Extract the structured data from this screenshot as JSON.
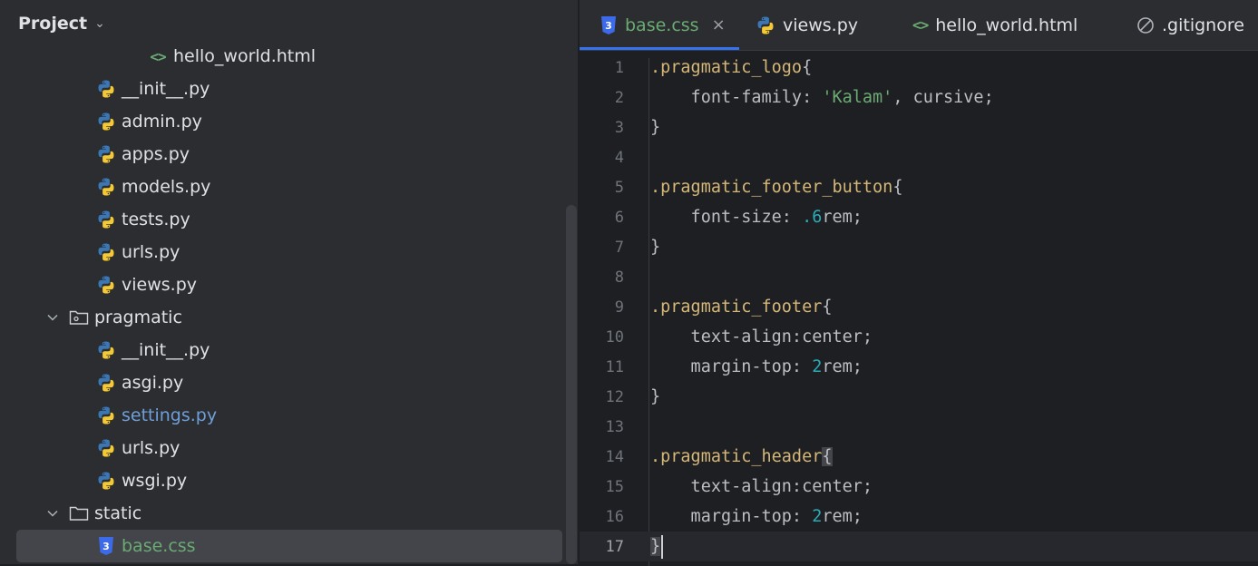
{
  "project": {
    "title": "Project",
    "items": [
      {
        "label": "hello_world.html",
        "icon": "html-icon",
        "indent": 145,
        "expander": null,
        "style": ""
      },
      {
        "label": "__init__.py",
        "icon": "python-icon",
        "indent": 88,
        "expander": null,
        "style": ""
      },
      {
        "label": "admin.py",
        "icon": "python-icon",
        "indent": 88,
        "expander": null,
        "style": ""
      },
      {
        "label": "apps.py",
        "icon": "python-icon",
        "indent": 88,
        "expander": null,
        "style": ""
      },
      {
        "label": "models.py",
        "icon": "python-icon",
        "indent": 88,
        "expander": null,
        "style": ""
      },
      {
        "label": "tests.py",
        "icon": "python-icon",
        "indent": 88,
        "expander": null,
        "style": ""
      },
      {
        "label": "urls.py",
        "icon": "python-icon",
        "indent": 88,
        "expander": null,
        "style": ""
      },
      {
        "label": "views.py",
        "icon": "python-icon",
        "indent": 88,
        "expander": null,
        "style": ""
      },
      {
        "label": "pragmatic",
        "icon": "package-folder-icon",
        "indent": 30,
        "expander": "open",
        "style": ""
      },
      {
        "label": "__init__.py",
        "icon": "python-icon",
        "indent": 88,
        "expander": null,
        "style": ""
      },
      {
        "label": "asgi.py",
        "icon": "python-icon",
        "indent": 88,
        "expander": null,
        "style": ""
      },
      {
        "label": "settings.py",
        "icon": "python-icon",
        "indent": 88,
        "expander": null,
        "style": "blue"
      },
      {
        "label": "urls.py",
        "icon": "python-icon",
        "indent": 88,
        "expander": null,
        "style": ""
      },
      {
        "label": "wsgi.py",
        "icon": "python-icon",
        "indent": 88,
        "expander": null,
        "style": ""
      },
      {
        "label": "static",
        "icon": "folder-icon",
        "indent": 30,
        "expander": "open",
        "style": ""
      },
      {
        "label": "base.css",
        "icon": "css-icon",
        "indent": 88,
        "expander": null,
        "style": "green",
        "selected": true
      }
    ]
  },
  "tabs": [
    {
      "label": "base.css",
      "icon": "css-icon",
      "active": true,
      "close": "×"
    },
    {
      "label": "views.py",
      "icon": "python-icon",
      "active": false
    },
    {
      "label": "hello_world.html",
      "icon": "html-icon",
      "active": false
    },
    {
      "label": ".gitignore",
      "icon": "ignored-file-icon",
      "active": false
    }
  ],
  "editor": {
    "current_line": 17,
    "lines": [
      [
        [
          "sel",
          ".pragmatic_logo"
        ],
        [
          "brace",
          "{"
        ]
      ],
      [
        [
          "prop",
          "    font-family: "
        ],
        [
          "str",
          "'Kalam'"
        ],
        [
          "prop",
          ", cursive;"
        ]
      ],
      [
        [
          "brace",
          "}"
        ]
      ],
      [],
      [
        [
          "sel",
          ".pragmatic_footer_button"
        ],
        [
          "brace",
          "{"
        ]
      ],
      [
        [
          "prop",
          "    font-size: "
        ],
        [
          "num",
          ".6"
        ],
        [
          "prop",
          "rem;"
        ]
      ],
      [
        [
          "brace",
          "}"
        ]
      ],
      [],
      [
        [
          "sel",
          ".pragmatic_footer"
        ],
        [
          "brace",
          "{"
        ]
      ],
      [
        [
          "prop",
          "    text-align:center;"
        ]
      ],
      [
        [
          "prop",
          "    margin-top: "
        ],
        [
          "num",
          "2"
        ],
        [
          "prop",
          "rem;"
        ]
      ],
      [
        [
          "brace",
          "}"
        ]
      ],
      [],
      [
        [
          "sel",
          ".pragmatic_header"
        ],
        [
          "bracematch",
          "{"
        ]
      ],
      [
        [
          "prop",
          "    text-align:center;"
        ]
      ],
      [
        [
          "prop",
          "    margin-top: "
        ],
        [
          "num",
          "2"
        ],
        [
          "prop",
          "rem;"
        ]
      ],
      [
        [
          "bracematch",
          "}"
        ]
      ]
    ]
  },
  "colors": {
    "accent": "#3574f0",
    "css_green": "#6aab73",
    "python_blue": "#3b77b5",
    "python_yellow": "#f5c933"
  }
}
